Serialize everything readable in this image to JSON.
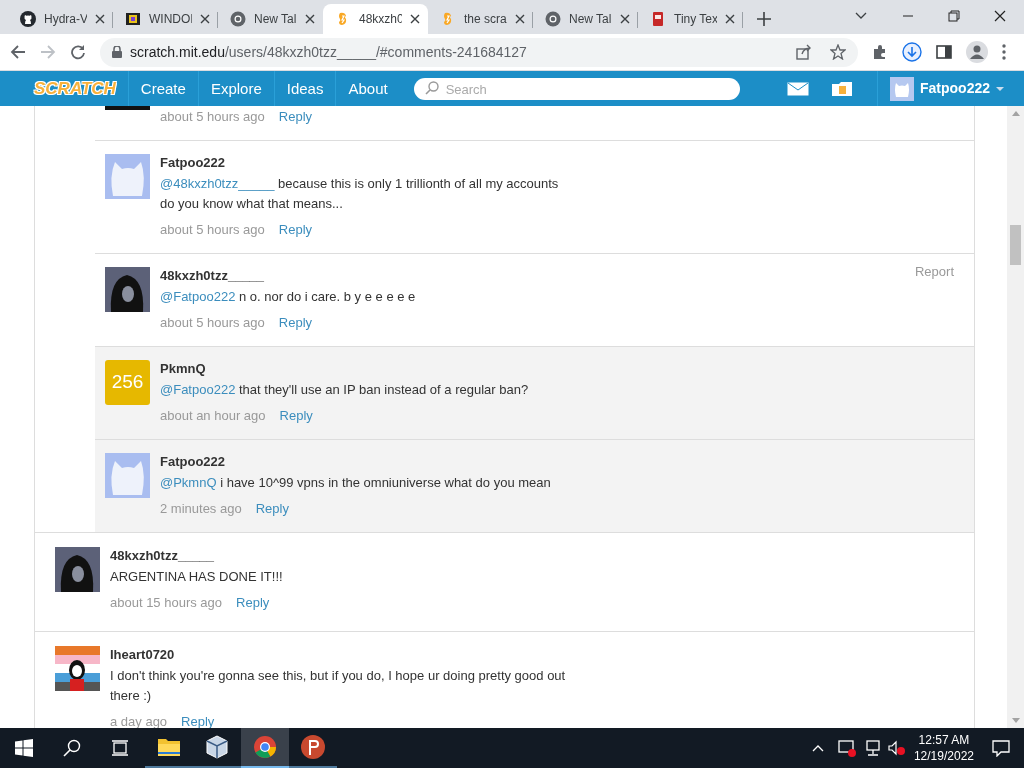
{
  "browser": {
    "tabs": [
      {
        "title": "Hydra-V",
        "kind": "github",
        "selected": false
      },
      {
        "title": "WINDOI",
        "kind": "film",
        "selected": false
      },
      {
        "title": "New Tal",
        "kind": "chrome",
        "selected": false
      },
      {
        "title": "48kxzh0",
        "kind": "scratch",
        "selected": true
      },
      {
        "title": "the scra",
        "kind": "scratch",
        "selected": false
      },
      {
        "title": "New Tal",
        "kind": "chrome",
        "selected": false
      },
      {
        "title": "Tiny Tex",
        "kind": "book",
        "selected": false
      }
    ],
    "url_host": "scratch.mit.edu",
    "url_path": "/users/48kxzh0tzz_____/#comments-241684127"
  },
  "site_nav": {
    "logo": "SCRATCH",
    "links": [
      "Create",
      "Explore",
      "Ideas",
      "About"
    ],
    "search": {
      "placeholder": "Search"
    },
    "username": "Fatpoo222"
  },
  "comments": [
    {
      "replies": [
        {
          "kind": "cropped",
          "time": "about 5 hours ago",
          "reply_label": "Reply",
          "shaded": false
        },
        {
          "author": "Fatpoo222",
          "kind": "cat",
          "mention": "@48kxzh0tzz_____",
          "text": " because this is only 1 trillionth of all my accounts do you know what that means...",
          "time": "about 5 hours ago",
          "reply_label": "Reply",
          "shaded": false
        },
        {
          "author": "48kxzh0tzz_____",
          "kind": "hood",
          "mention": "@Fatpoo222",
          "text": " n o. nor do i care. b y e e e e e",
          "time": "about 5 hours ago",
          "reply_label": "Reply",
          "report": "Report",
          "shaded": false
        },
        {
          "author": "PkmnQ",
          "kind": "number",
          "avatar_text": "256",
          "mention": "@Fatpoo222",
          "text": " that they'll use an IP ban instead of a regular ban?",
          "time": "about an hour ago",
          "reply_label": "Reply",
          "shaded": true
        },
        {
          "author": "Fatpoo222",
          "kind": "cat",
          "mention": "@PkmnQ",
          "text": " i have 10^99 vpns in the omniuniverse what do you mean",
          "time": "2 minutes ago",
          "reply_label": "Reply",
          "shaded": true
        }
      ]
    },
    {
      "author": "48kxzh0tzz_____",
      "kind": "hood",
      "text": "ARGENTINA HAS DONE IT!!!",
      "time": "about 15 hours ago",
      "reply_label": "Reply"
    },
    {
      "author": "Iheart0720",
      "kind": "flag",
      "text": "I don't think you're gonna see this, but if you do, I hope ur doing pretty good out there :)",
      "time": "a day ago",
      "reply_label": "Reply"
    }
  ],
  "taskbar": {
    "apps": [
      {
        "kind": "folder",
        "selected": false
      },
      {
        "kind": "cube",
        "selected": false
      },
      {
        "kind": "chrome",
        "selected": true
      },
      {
        "kind": "p",
        "selected": false
      }
    ],
    "time": "12:57 AM",
    "date": "12/19/2022"
  }
}
